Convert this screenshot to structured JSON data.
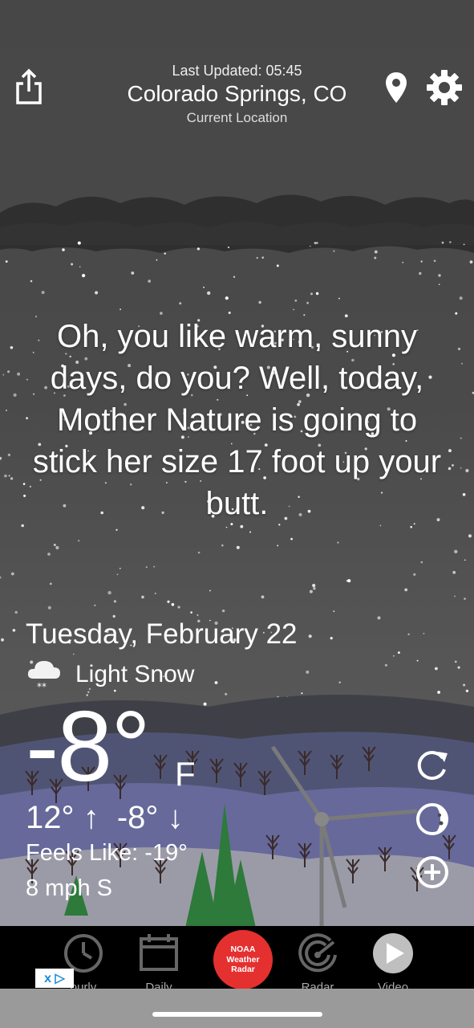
{
  "header": {
    "last_updated": "Last Updated: 05:45",
    "location": "Colorado Springs, CO",
    "sublocation": "Current Location"
  },
  "quote": "Oh, you like warm, sunny days, do you? Well, today, Mother Nature is going to stick her size 17 foot up your butt.",
  "weather": {
    "date": "Tuesday, February 22",
    "condition": "Light Snow",
    "condition_icon": "snow-cloud-icon",
    "temperature": "-8°",
    "unit": "F",
    "hi_lo": "12° ↑  -8° ↓",
    "feels_like": "Feels Like: -19°",
    "wind": "8 mph S"
  },
  "actions": [
    "refresh-icon",
    "moon-phase-icon",
    "add-icon"
  ],
  "tabbar": {
    "tabs": [
      {
        "label": "ourly",
        "icon": "clock-icon"
      },
      {
        "label": "Daily",
        "icon": "calendar-icon"
      },
      {
        "label": "Radar",
        "icon": "radar-icon"
      },
      {
        "label": "Video",
        "icon": "play-icon"
      }
    ],
    "noaa": {
      "line1": "NOAA",
      "line2": "Weather",
      "line3": "Radar"
    },
    "ad_badge": "x ▷"
  },
  "colors": {
    "tabbar_bg": "#000000",
    "noaa_red": "#e53030",
    "sky": "#474747"
  }
}
